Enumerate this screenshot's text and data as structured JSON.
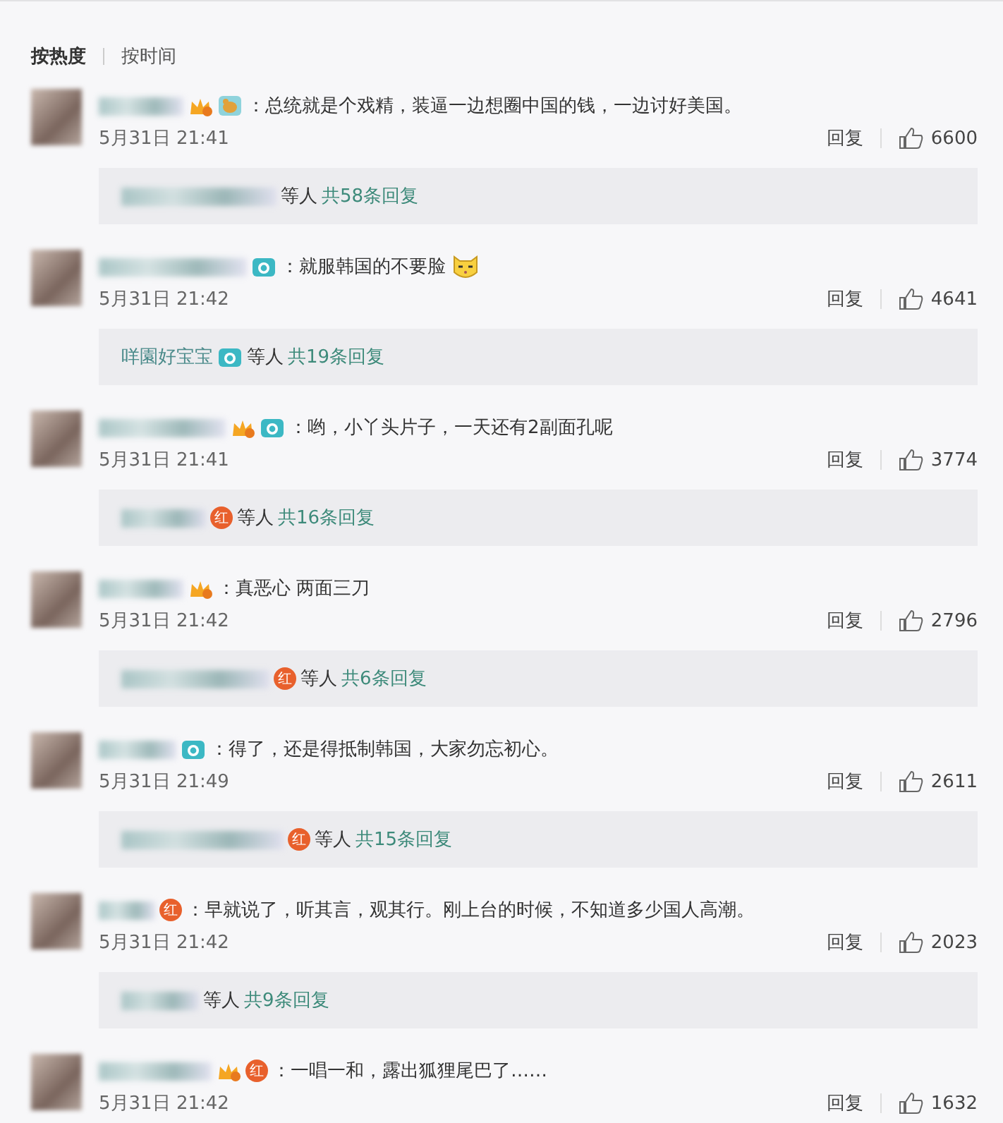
{
  "sort_tabs": [
    {
      "label": "按热度",
      "selected": true
    },
    {
      "label": "按时间",
      "selected": false
    }
  ],
  "comments": [
    {
      "author": {
        "kind": "blurred"
      },
      "badges": [
        {
          "kind": "vip"
        },
        {
          "kind": "bird"
        }
      ],
      "text": "：总统就是个戏精，装逼一边想圈中国的钱，一边讨好美国。",
      "time": "5月31日 21:41",
      "reply": "回复",
      "likes": "6600",
      "thread": {
        "author": {
          "kind": "blurred"
        },
        "suffix": "等人",
        "count": "共58条回复"
      }
    },
    {
      "author": {
        "kind": "blurred"
      },
      "badges": [
        {
          "kind": "camera"
        }
      ],
      "text": "：就服韩国的不要脸",
      "emoji": {
        "kind": "cat_face"
      },
      "time": "5月31日 21:42",
      "reply": "回复",
      "likes": "4641",
      "thread": {
        "author": {
          "kind": "name",
          "name": "咩園好宝宝"
        },
        "badges": [
          {
            "kind": "camera"
          }
        ],
        "suffix": "等人",
        "count": "共19条回复"
      }
    },
    {
      "author": {
        "kind": "blurred"
      },
      "badges": [
        {
          "kind": "vip"
        },
        {
          "kind": "camera"
        }
      ],
      "text": "：哟，小丫头片子，一天还有2副面孔呢",
      "time": "5月31日 21:41",
      "reply": "回复",
      "likes": "3774",
      "thread": {
        "author": {
          "kind": "blurred"
        },
        "badges": [
          {
            "kind": "red",
            "label": "红"
          }
        ],
        "suffix": "等人",
        "count": "共16条回复"
      }
    },
    {
      "author": {
        "kind": "blurred"
      },
      "badges": [
        {
          "kind": "vip"
        }
      ],
      "text": "：真恶心  两面三刀",
      "time": "5月31日 21:42",
      "reply": "回复",
      "likes": "2796",
      "thread": {
        "author": {
          "kind": "blurred"
        },
        "badges": [
          {
            "kind": "red",
            "label": "红"
          }
        ],
        "suffix": "等人",
        "count": "共6条回复"
      }
    },
    {
      "author": {
        "kind": "blurred"
      },
      "badges": [
        {
          "kind": "camera"
        }
      ],
      "text": "：得了，还是得抵制韩国，大家勿忘初心。",
      "time": "5月31日 21:49",
      "reply": "回复",
      "likes": "2611",
      "thread": {
        "author": {
          "kind": "blurred"
        },
        "badges": [
          {
            "kind": "red",
            "label": "红"
          }
        ],
        "suffix": "等人",
        "count": "共15条回复"
      }
    },
    {
      "author": {
        "kind": "blurred"
      },
      "badges": [
        {
          "kind": "red",
          "label": "红"
        }
      ],
      "text": "：早就说了，听其言，观其行。刚上台的时候，不知道多少国人高潮。",
      "time": "5月31日 21:42",
      "reply": "回复",
      "likes": "2023",
      "thread": {
        "author": {
          "kind": "blurred"
        },
        "suffix": "等人",
        "count": "共9条回复"
      }
    },
    {
      "author": {
        "kind": "blurred"
      },
      "badges": [
        {
          "kind": "vip"
        },
        {
          "kind": "red",
          "label": "红"
        }
      ],
      "text": "：一唱一和，露出狐狸尾巴了……",
      "time": "5月31日 21:42",
      "reply": "回复",
      "likes": "1632"
    }
  ]
}
